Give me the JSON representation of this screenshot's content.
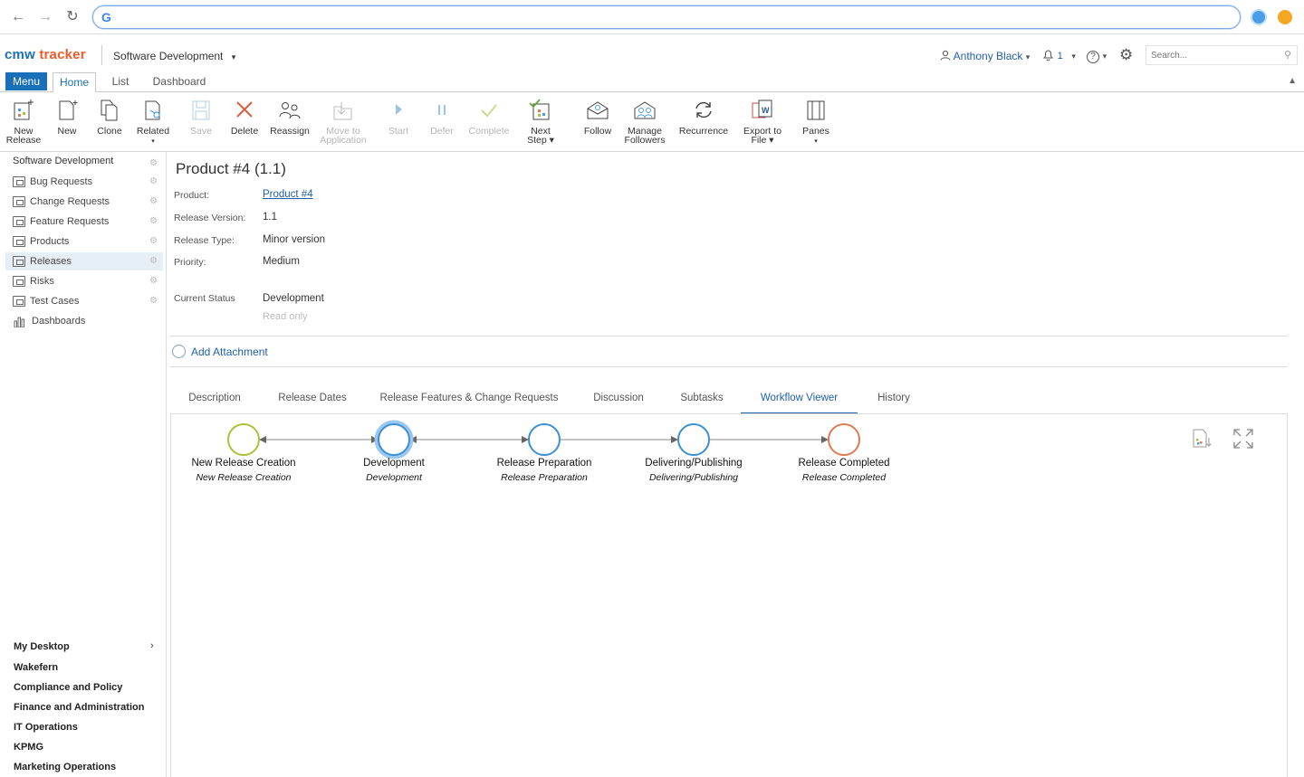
{
  "browser": {
    "omnibox_value": ""
  },
  "header": {
    "brand_part1": "cmw",
    "brand_part2": "tracker",
    "workspace": "Software Development",
    "user_name": "Anthony Black",
    "notification_count": "1",
    "search_placeholder": "Search..."
  },
  "ribbon": {
    "menu_label": "Menu",
    "tabs": [
      "Home",
      "List",
      "Dashboard"
    ],
    "active_tab": "Home"
  },
  "toolbar": {
    "buttons": [
      {
        "line1": "New",
        "line2": "Release",
        "icon": "new-release-icon",
        "enabled": true
      },
      {
        "line1": "New",
        "line2": "",
        "icon": "new-document-icon",
        "enabled": true
      },
      {
        "line1": "Clone",
        "line2": "",
        "icon": "clone-icon",
        "enabled": true
      },
      {
        "line1": "Related",
        "line2": "▾",
        "icon": "related-icon",
        "enabled": true
      },
      {
        "line1": "Save",
        "line2": "",
        "icon": "save-icon",
        "enabled": false
      },
      {
        "line1": "Delete",
        "line2": "",
        "icon": "delete-icon",
        "enabled": true
      },
      {
        "line1": "Reassign",
        "line2": "",
        "icon": "reassign-icon",
        "enabled": true
      },
      {
        "line1": "Move to",
        "line2": "Application",
        "icon": "move-icon",
        "enabled": false
      },
      {
        "line1": "Start",
        "line2": "",
        "icon": "play-icon",
        "enabled": false
      },
      {
        "line1": "Defer",
        "line2": "",
        "icon": "pause-icon",
        "enabled": false
      },
      {
        "line1": "Complete",
        "line2": "",
        "icon": "check-icon",
        "enabled": false
      },
      {
        "line1": "Next",
        "line2": "Step ▾",
        "icon": "next-step-icon",
        "enabled": true
      },
      {
        "line1": "Follow",
        "line2": "",
        "icon": "follow-icon",
        "enabled": true
      },
      {
        "line1": "Manage",
        "line2": "Followers",
        "icon": "manage-followers-icon",
        "enabled": true
      },
      {
        "line1": "Recurrence",
        "line2": "",
        "icon": "recurrence-icon",
        "enabled": true
      },
      {
        "line1": "Export to",
        "line2": "File ▾",
        "icon": "export-icon",
        "enabled": true
      },
      {
        "line1": "Panes",
        "line2": "▾",
        "icon": "panes-icon",
        "enabled": true
      }
    ]
  },
  "sidebar": {
    "root": "Software Development",
    "items": [
      {
        "label": "Bug Requests"
      },
      {
        "label": "Change Requests"
      },
      {
        "label": "Feature Requests"
      },
      {
        "label": "Products"
      },
      {
        "label": "Releases"
      },
      {
        "label": "Risks"
      },
      {
        "label": "Test Cases"
      },
      {
        "label": "Dashboards"
      }
    ],
    "active_item": "Releases",
    "workspaces": [
      "My Desktop",
      "Wakefern",
      "Compliance and Policy",
      "Finance and Administration",
      "IT Operations",
      "KPMG",
      "Marketing Operations"
    ]
  },
  "record": {
    "title": "Product #4 (1.1)",
    "fields": [
      {
        "label": "Product:",
        "value": "Product #4"
      },
      {
        "label": "Release Version:",
        "value": "1.1"
      },
      {
        "label": "Release Type:",
        "value": "Minor version"
      },
      {
        "label": "Priority:",
        "value": "Medium"
      }
    ],
    "status_label": "Current Status",
    "status_value": "Development",
    "status_note": "Read only",
    "add_attachment": "Add Attachment"
  },
  "tabs": [
    "Description",
    "Release Dates",
    "Release Features & Change Requests",
    "Discussion",
    "Subtasks",
    "Workflow Viewer",
    "History"
  ],
  "active_tab": "Workflow Viewer",
  "workflow": {
    "stages": [
      {
        "name": "New Release Creation",
        "sub": "New Release Creation",
        "color": "#a8c23a"
      },
      {
        "name": "Development",
        "sub": "Development",
        "color": "#3b8fd6"
      },
      {
        "name": "Release Preparation",
        "sub": "Release Preparation",
        "color": "#3b8fd6"
      },
      {
        "name": "Delivering/Publishing",
        "sub": "Delivering/Publishing",
        "color": "#3b8fd6"
      },
      {
        "name": "Release Completed",
        "sub": "Release Completed",
        "color": "#e07a52"
      }
    ],
    "current_stage": "Development"
  },
  "colors": {
    "accent": "#1a6fb9",
    "brand_orange": "#f05a28",
    "link": "#1f5fa8"
  }
}
